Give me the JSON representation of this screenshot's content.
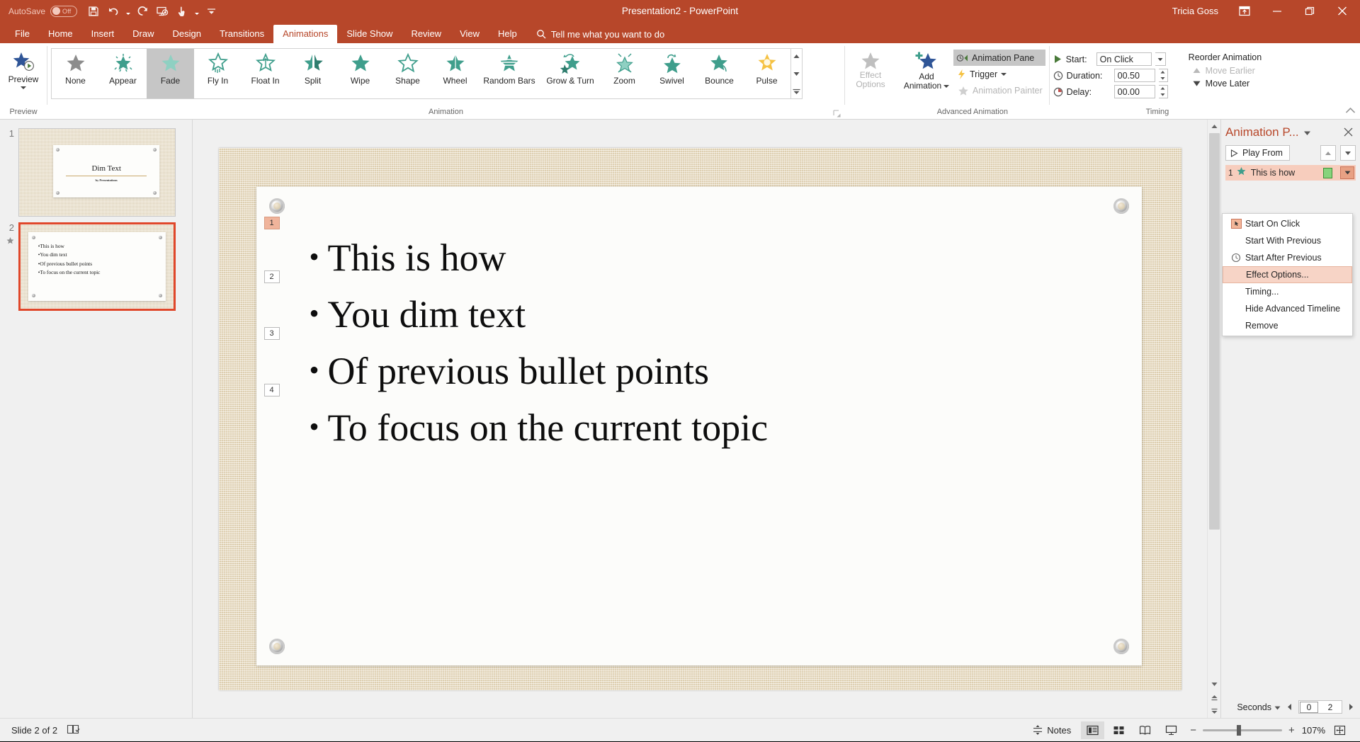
{
  "titlebar": {
    "autosave_label": "AutoSave",
    "autosave_state": "Off",
    "document_title": "Presentation2  -  PowerPoint",
    "user_name": "Tricia Goss",
    "qat": [
      {
        "name": "save-icon",
        "label": "Save"
      },
      {
        "name": "undo-icon",
        "label": "Undo"
      },
      {
        "name": "redo-icon",
        "label": "Redo"
      },
      {
        "name": "start-from-beginning-icon",
        "label": "Start From Beginning"
      },
      {
        "name": "touch-mouse-mode-icon",
        "label": "Touch/Mouse Mode"
      },
      {
        "name": "customize-qat-icon",
        "label": "Customize Quick Access Toolbar"
      }
    ],
    "window_buttons": [
      "ribbon-display-options",
      "minimize",
      "restore",
      "close"
    ]
  },
  "tabs": [
    {
      "label": "File",
      "active": false
    },
    {
      "label": "Home",
      "active": false
    },
    {
      "label": "Insert",
      "active": false
    },
    {
      "label": "Draw",
      "active": false
    },
    {
      "label": "Design",
      "active": false
    },
    {
      "label": "Transitions",
      "active": false
    },
    {
      "label": "Animations",
      "active": true
    },
    {
      "label": "Slide Show",
      "active": false
    },
    {
      "label": "Review",
      "active": false
    },
    {
      "label": "View",
      "active": false
    },
    {
      "label": "Help",
      "active": false
    }
  ],
  "tellme": {
    "label": "Tell me what you want to do"
  },
  "ribbon": {
    "groups": {
      "preview": {
        "label": "Preview",
        "button_label": "Preview"
      },
      "animation": {
        "label": "Animation"
      },
      "advanced": {
        "label": "Advanced Animation"
      },
      "timing": {
        "label": "Timing"
      }
    },
    "gallery": [
      {
        "label": "None",
        "selected": false
      },
      {
        "label": "Appear",
        "selected": false
      },
      {
        "label": "Fade",
        "selected": true
      },
      {
        "label": "Fly In",
        "selected": false
      },
      {
        "label": "Float In",
        "selected": false
      },
      {
        "label": "Split",
        "selected": false
      },
      {
        "label": "Wipe",
        "selected": false
      },
      {
        "label": "Shape",
        "selected": false
      },
      {
        "label": "Wheel",
        "selected": false
      },
      {
        "label": "Random Bars",
        "selected": false
      },
      {
        "label": "Grow & Turn",
        "selected": false
      },
      {
        "label": "Zoom",
        "selected": false
      },
      {
        "label": "Swivel",
        "selected": false
      },
      {
        "label": "Bounce",
        "selected": false
      },
      {
        "label": "Pulse",
        "selected": false
      }
    ],
    "effect_options": {
      "line1": "Effect",
      "line2": "Options"
    },
    "advanced": {
      "add_animation_line1": "Add",
      "add_animation_line2": "Animation",
      "animation_pane": "Animation Pane",
      "trigger": "Trigger",
      "animation_painter": "Animation Painter"
    },
    "timing": {
      "start_label": "Start:",
      "start_value": "On Click",
      "duration_label": "Duration:",
      "duration_value": "00.50",
      "delay_label": "Delay:",
      "delay_value": "00.00",
      "reorder_title": "Reorder Animation",
      "move_earlier": "Move Earlier",
      "move_later": "Move Later"
    }
  },
  "thumbnails": [
    {
      "number": "1",
      "active": false,
      "has_animation": false,
      "title": "Dim Text",
      "subtitle": "by Presentations"
    },
    {
      "number": "2",
      "active": true,
      "has_animation": true,
      "bullets": [
        "This is how",
        "You dim text",
        "Of previous bullet points",
        "To focus on the current topic"
      ]
    }
  ],
  "slide": {
    "bullets": [
      {
        "badge": "1",
        "text": "This is how",
        "current": true
      },
      {
        "badge": "2",
        "text": "You dim text",
        "current": false
      },
      {
        "badge": "3",
        "text": "Of previous bullet points",
        "current": false
      },
      {
        "badge": "4",
        "text": "To focus on the current topic",
        "current": false
      }
    ]
  },
  "animation_pane": {
    "title": "Animation P...",
    "play_from": "Play From",
    "item": {
      "index": "1",
      "name": "This is how"
    },
    "context_menu": [
      {
        "label": "Start On Click",
        "icon": "mouse-click-icon",
        "highlighted": false
      },
      {
        "label": "Start With Previous",
        "icon": "",
        "highlighted": false
      },
      {
        "label": "Start After Previous",
        "icon": "clock-icon",
        "highlighted": false
      },
      {
        "label": "Effect Options...",
        "icon": "",
        "highlighted": true
      },
      {
        "label": "Timing...",
        "icon": "",
        "highlighted": false
      },
      {
        "label": "Hide Advanced Timeline",
        "icon": "",
        "highlighted": false
      },
      {
        "label": "Remove",
        "icon": "",
        "highlighted": false
      }
    ],
    "seconds_label": "Seconds",
    "scale_start": "0",
    "scale_end": "2"
  },
  "status": {
    "slide_indicator": "Slide 2 of 2",
    "notes_label": "Notes",
    "zoom_level": "107%",
    "views": [
      "Normal",
      "Slide Sorter",
      "Reading View",
      "Slide Show"
    ]
  },
  "colors": {
    "brand": "#b7472a",
    "accent_selected": "#f7cdbd",
    "animation_star": "#3f9e8c",
    "timeline_green": "#87d37c"
  }
}
